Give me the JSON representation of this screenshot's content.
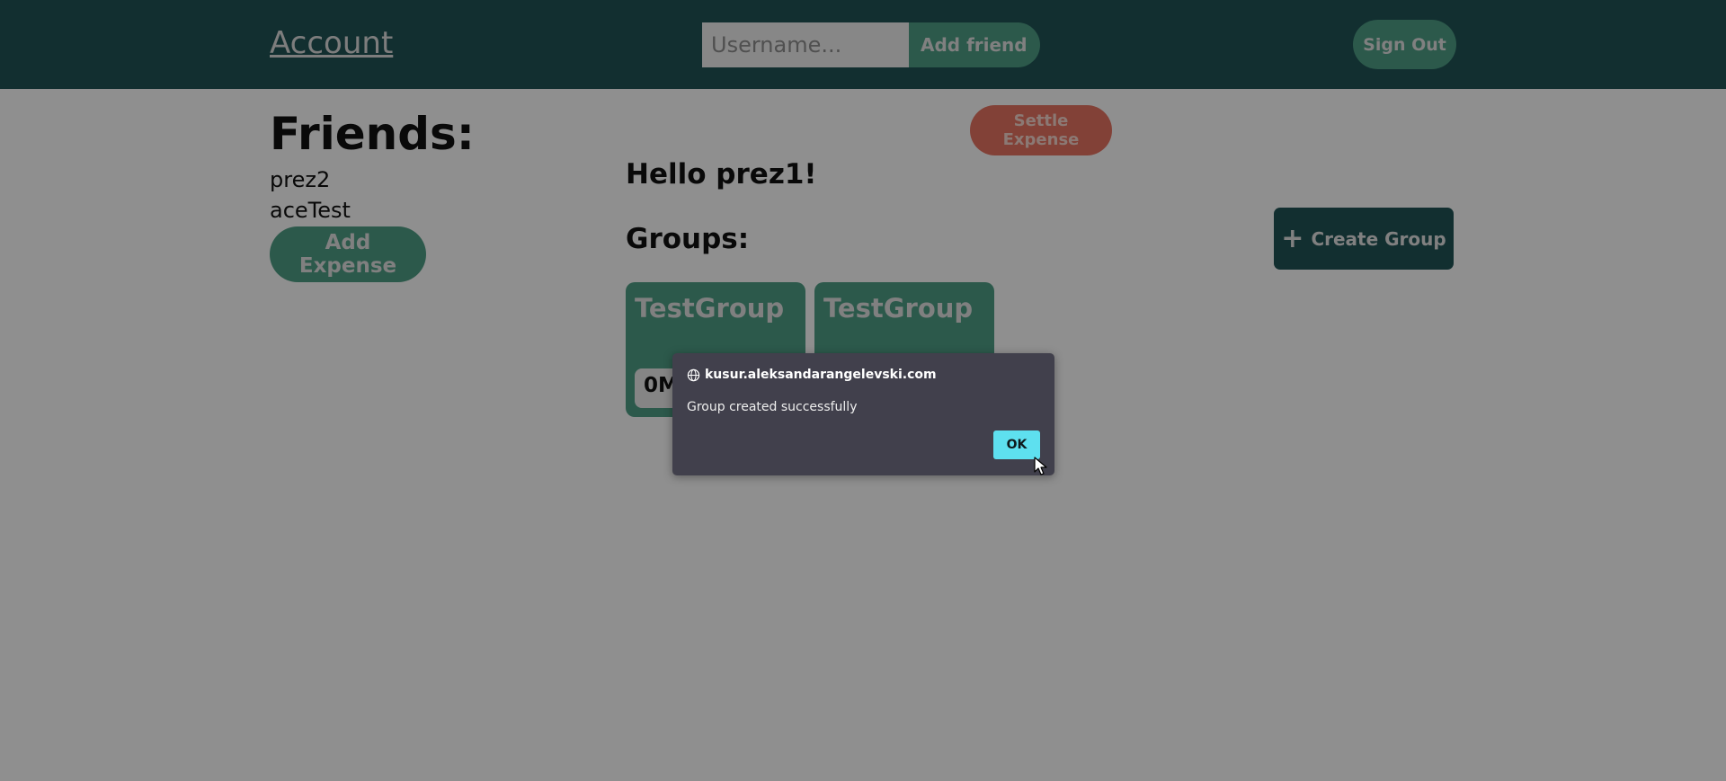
{
  "header": {
    "account_link": "Account",
    "username_placeholder": "Username...",
    "add_friend_label": "Add friend",
    "sign_out_label": "Sign Out"
  },
  "friends": {
    "title": "Friends:",
    "items": [
      {
        "name": "prez2"
      },
      {
        "name": "aceTest"
      }
    ],
    "add_expense_label": "Add Expense"
  },
  "main": {
    "settle_expense_label": "Settle Expense",
    "greeting": "Hello prez1!",
    "groups_title": "Groups:",
    "create_group_label": "Create Group",
    "groups": [
      {
        "name": "TestGroup",
        "balance": "0M"
      },
      {
        "name": "TestGroup",
        "balance": ""
      }
    ]
  },
  "dialog": {
    "origin": "kusur.aleksandarangelevski.com",
    "message": "Group created successfully",
    "ok_label": "OK"
  },
  "colors": {
    "header_bg": "#1f5154",
    "accent_green": "#4d9a81",
    "settle_red": "#e0705f",
    "dialog_bg": "#41404c",
    "ok_button": "#5ee0ef"
  },
  "icons": {
    "create_group": "plus-icon",
    "dialog_origin": "globe-icon",
    "pointer": "cursor-icon"
  }
}
